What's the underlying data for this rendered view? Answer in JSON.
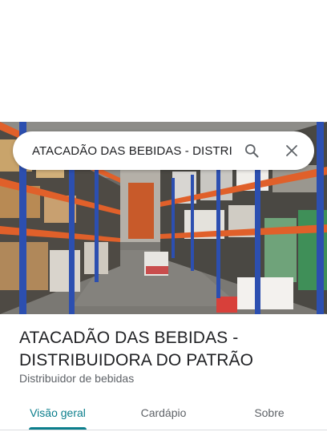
{
  "search": {
    "query": "ATACADÃO DAS BEBIDAS - DISTRIB",
    "search_icon": "search-icon",
    "clear_icon": "close-icon"
  },
  "place": {
    "name": "ATACADÃO DAS BEBIDAS - DISTRIBUIDORA DO PATRÃO",
    "category": "Distribuidor de bebidas"
  },
  "tabs": [
    {
      "label": "Visão geral",
      "active": true
    },
    {
      "label": "Cardápio",
      "active": false
    },
    {
      "label": "Sobre",
      "active": false
    }
  ],
  "colors": {
    "accent": "#0b7e8c",
    "text_primary": "#202124",
    "text_secondary": "#5f6368"
  }
}
